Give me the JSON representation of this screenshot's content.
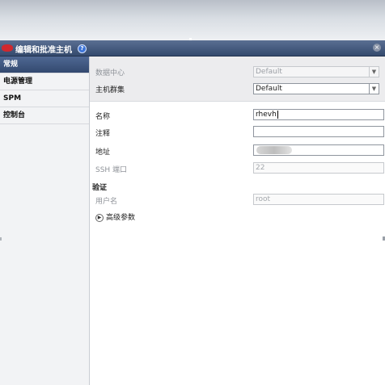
{
  "dialog": {
    "title": "编辑和批准主机",
    "help_icon": "?",
    "close_icon": "×"
  },
  "sidebar": {
    "items": [
      {
        "label": "常规",
        "active": true
      },
      {
        "label": "电源管理",
        "active": false
      },
      {
        "label": "SPM",
        "active": false
      },
      {
        "label": "控制台",
        "active": false
      }
    ]
  },
  "form": {
    "datacenter": {
      "label": "数据中心",
      "value": "Default",
      "enabled": false
    },
    "cluster": {
      "label": "主机群集",
      "value": "Default",
      "enabled": true
    },
    "name": {
      "label": "名称",
      "value": "rhevh"
    },
    "comment": {
      "label": "注释",
      "value": ""
    },
    "address": {
      "label": "地址",
      "value": ""
    },
    "ssh_port": {
      "label": "SSH 端口",
      "value": "22"
    },
    "auth_title": "验证",
    "username": {
      "label": "用户名",
      "value": "root"
    },
    "advanced": {
      "label": "高级参数",
      "icon": "expand-arrow-icon"
    }
  },
  "colors": {
    "titlebar": "#344a6e",
    "active_tab": "#3f5680",
    "logo_red": "#d0282e",
    "help_blue": "#3d74d6"
  }
}
